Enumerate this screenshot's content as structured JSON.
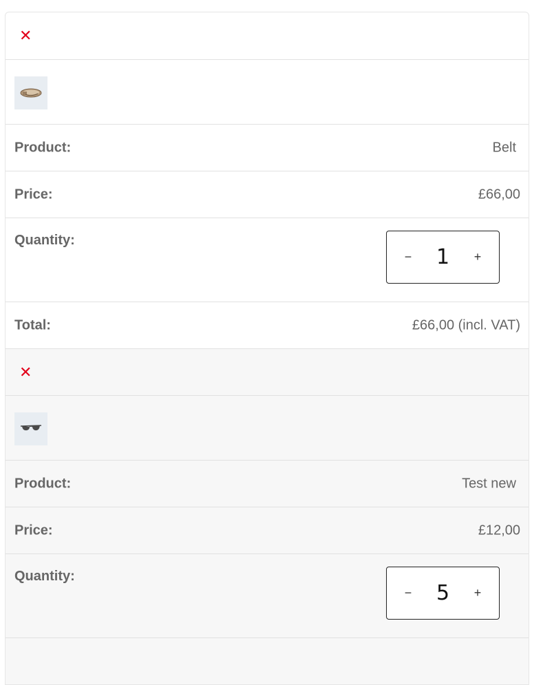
{
  "labels": {
    "product": "Product:",
    "price": "Price:",
    "quantity": "Quantity:",
    "total": "Total:"
  },
  "icons": {
    "remove": "close-icon",
    "decrement": "minus-icon",
    "increment": "plus-icon"
  },
  "colors": {
    "remove_icon": "#e2001a",
    "alt_row_bg": "#f7f7f7"
  },
  "cart": {
    "items": [
      {
        "remove_symbol": "✕",
        "thumbnail": "belt-thumbnail",
        "product": "Belt",
        "price": "£66,00",
        "quantity": "1",
        "decrement_symbol": "−",
        "increment_symbol": "+",
        "total": "£66,00 (incl. VAT)"
      },
      {
        "remove_symbol": "✕",
        "thumbnail": "sunglasses-thumbnail",
        "product": "Test new",
        "price": "£12,00",
        "quantity": "5",
        "decrement_symbol": "−",
        "increment_symbol": "+"
      }
    ]
  }
}
